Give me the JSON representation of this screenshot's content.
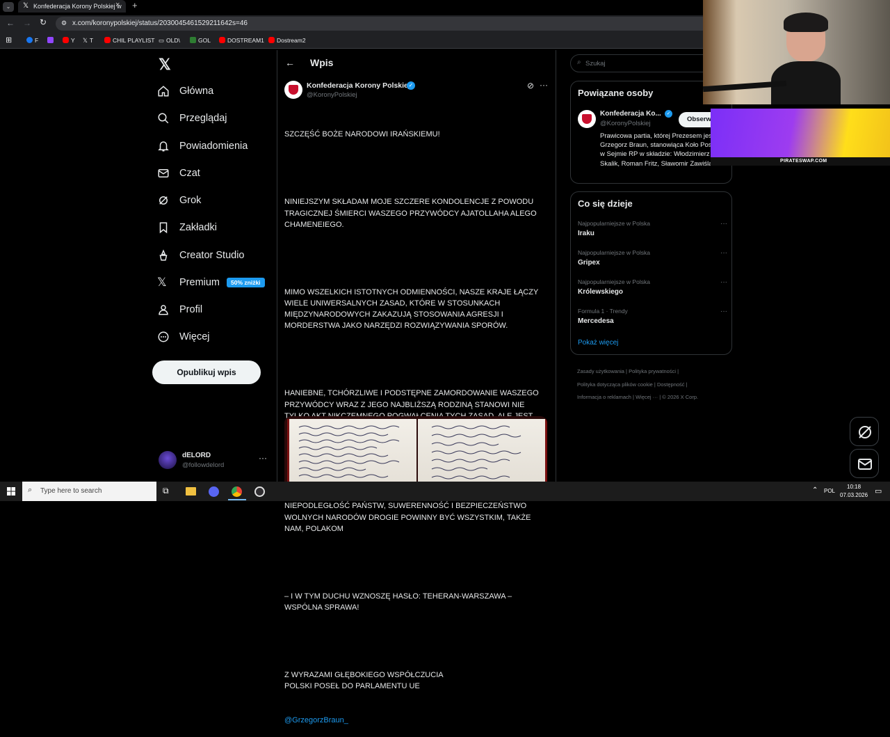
{
  "browser": {
    "tab_title": "Konfederacja Korony Polskiej w",
    "url": "x.com/koronypolskiej/status/2030045461529211642s=46",
    "bookmarks": [
      "F",
      "Y",
      "T",
      "CHIL PLAYLIST",
      "OLD\\",
      "GOL",
      "DOSTREAM1",
      "Dostream2"
    ]
  },
  "nav": {
    "items": [
      {
        "label": "Główna",
        "icon": "home-icon"
      },
      {
        "label": "Przeglądaj",
        "icon": "search-icon"
      },
      {
        "label": "Powiadomienia",
        "icon": "bell-icon"
      },
      {
        "label": "Czat",
        "icon": "mail-icon"
      },
      {
        "label": "Grok",
        "icon": "grok-icon"
      },
      {
        "label": "Zakładki",
        "icon": "bookmark-icon"
      },
      {
        "label": "Creator Studio",
        "icon": "creator-icon"
      },
      {
        "label": "Premium",
        "icon": "x-icon"
      },
      {
        "label": "Profil",
        "icon": "person-icon"
      },
      {
        "label": "Więcej",
        "icon": "more-circle-icon"
      }
    ],
    "premium_badge": "50% zniżki",
    "publish_label": "Opublikuj wpis",
    "account_name": "dELORD",
    "account_handle": "@followdelord"
  },
  "post": {
    "header_title": "Wpis",
    "author_name": "Konfederacja Korony Polskiej",
    "author_handle": "@KoronyPolskiej",
    "paragraphs": [
      "SZCZĘŚĆ BOŻE NARODOWI IRAŃSKIEMU!",
      "NINIEJSZYM SKŁADAM MOJE SZCZERE KONDOLENCJE Z POWODU TRAGICZNEJ ŚMIERCI WASZEGO PRZYWÓDCY AJATOLLAHA ALEGO CHAMENEIEGO.",
      "MIMO WSZELKICH ISTOTNYCH ODMIENNOŚCI, NASZE KRAJE ŁĄCZY WIELE UNIWERSALNYCH ZASAD, KTÓRE W STOSUNKACH MIĘDZYNARODOWYCH ZAKAZUJĄ STOSOWANIA AGRESJI I MORDERSTWA JAKO NARZĘDZI ROZWIĄZYWANIA SPORÓW.",
      "HANIEBNE, TCHÓRZLIWE I PODSTĘPNE ZAMORDOWANIE WASZEGO PRZYWÓDCY WRAZ Z JEGO NAJBLIŻSZĄ RODZINĄ STANOWI NIE TYLKO AKT NIKCZEMNEGO POGWAŁCENIA TYCH ZASAD, ALE JEST TAKŻE PRZEJAWEM UPADKU CYWILIZACYJNEGO I OSOBISTEGO ZDZICZENIA TYCH, KTÓRZY TAKIEGO AKTU SIĘ DOPUŚCILI.",
      "NIEPODLEGŁOŚĆ PAŃSTW, SUWERENNOŚĆ I BEZPIECZEŃSTWO WOLNYCH NARODÓW DROGIE POWINNY BYĆ WSZYSTKIM, TAKŻE NAM, POLAKOM",
      "– I W TYM DUCHU WZNOSZĘ HASŁO: TEHERAN-WARSZAWA – WSPÓLNA SPRAWA!",
      "Z WYRAZAMI GŁĘBOKIEGO WSPÓŁCZUCIA\nPOLSKI POSEŁ DO PARLAMENTU UE"
    ],
    "mention": "@GrzegorzBraun_"
  },
  "right": {
    "search_placeholder": "Szukaj",
    "related_title": "Powiązane osoby",
    "related_name": "Konfederacja Ko...",
    "related_handle": "@KoronyPolskiej",
    "follow_label": "Obserwuj",
    "related_bio": "Prawicowa partia, której Prezesem jest Grzegorz Braun, stanowiąca Koło Poselskie w Sejmie RP w składzie: Włodzimierz Skalik, Roman Fritz, Sławomir Zawiślak.",
    "trends_title": "Co się dzieje",
    "trends": [
      {
        "context": "Najpopularniejsze w Polska",
        "name": "Iraku"
      },
      {
        "context": "Najpopularniejsze w Polska",
        "name": "Gripex"
      },
      {
        "context": "Najpopularniejsze w Polska",
        "name": "Królewskiego"
      },
      {
        "context": "Formula 1 · Trendy",
        "name": "Mercedesa"
      }
    ],
    "show_more": "Pokaż więcej",
    "footer_row1": [
      "Zasady użytkowania",
      "Polityka prywatności"
    ],
    "footer_row2": [
      "Polityka dotycząca plików cookie",
      "Dostępność"
    ],
    "footer_row3": [
      "Informacja o reklamach",
      "Więcej ···",
      "© 2026 X Corp."
    ]
  },
  "overlay": {
    "banner_text": "PIRATESWAP.COM"
  },
  "taskbar": {
    "search_placeholder": "Type here to search",
    "lang": "POL",
    "time": "10:18",
    "date": "07.03.2026"
  },
  "colors": {
    "accent": "#1d9bf0",
    "bg": "#000000",
    "border": "#2f3336",
    "muted": "#71767b"
  }
}
